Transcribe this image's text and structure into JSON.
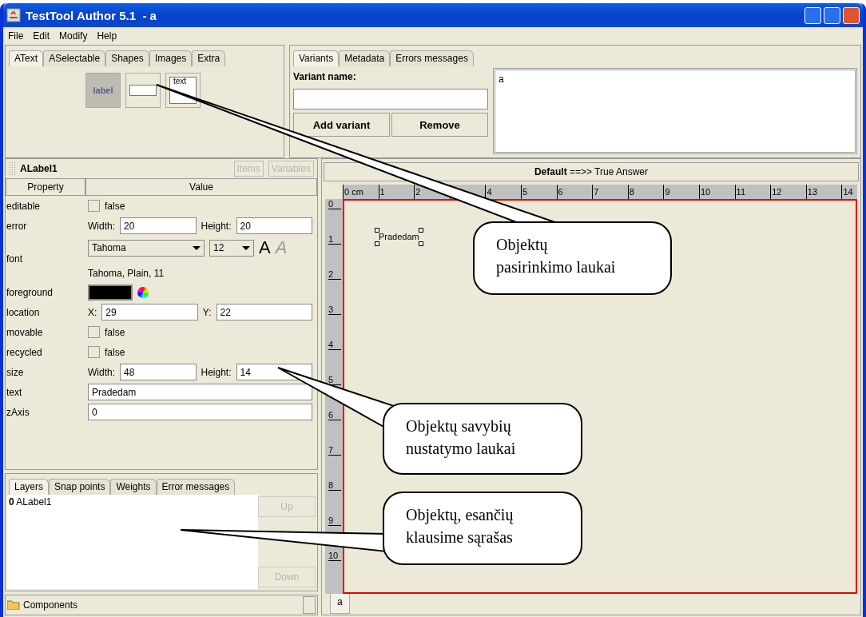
{
  "window": {
    "title": "TestTool Author 5.1  - a"
  },
  "menu": [
    "File",
    "Edit",
    "Modify",
    "Help"
  ],
  "palette": {
    "tabs": [
      {
        "label": "AText",
        "selected": true
      },
      {
        "label": "ASelectable",
        "selected": false
      },
      {
        "label": "Shapes",
        "selected": false
      },
      {
        "label": "Images",
        "selected": false
      },
      {
        "label": "Extra",
        "selected": false
      }
    ],
    "tools": [
      {
        "kind": "label",
        "text": "label",
        "selected": true
      },
      {
        "kind": "textfield",
        "selected": false
      },
      {
        "kind": "textarea",
        "text": "text",
        "selected": false
      }
    ]
  },
  "variants": {
    "tabs": [
      {
        "label": "Variants",
        "selected": true
      },
      {
        "label": "Metadata",
        "selected": false
      },
      {
        "label": "Errors messages",
        "selected": false
      }
    ],
    "name_label": "Variant name:",
    "buttons": [
      "Add variant",
      "Remove"
    ],
    "list": [
      "a"
    ]
  },
  "properties": {
    "title": "ALabel1",
    "buttons": [
      {
        "label": "Items",
        "disabled": true
      },
      {
        "label": "Variables",
        "disabled": true
      }
    ],
    "columns": [
      "Property",
      "Value"
    ],
    "rows": [
      {
        "name": "editable",
        "kind": "checkbox",
        "checked": false,
        "label": "false"
      },
      {
        "name": "error",
        "kind": "pair",
        "fields": [
          {
            "label": "Width:",
            "value": "20"
          },
          {
            "label": "Height:",
            "value": "20"
          }
        ]
      },
      {
        "name": "font",
        "kind": "font",
        "family": "Tahoma",
        "size": "12",
        "styles": [
          {
            "glyph": "A",
            "kind": "plain",
            "selected": true
          },
          {
            "glyph": "A",
            "kind": "italic",
            "selected": false
          }
        ],
        "description": "Tahoma, Plain, 11"
      },
      {
        "name": "foreground",
        "kind": "color",
        "color": "#000000"
      },
      {
        "name": "location",
        "kind": "pair",
        "fields": [
          {
            "label": "X:",
            "value": "29"
          },
          {
            "label": "Y:",
            "value": "22"
          }
        ]
      },
      {
        "name": "movable",
        "kind": "checkbox",
        "checked": false,
        "label": "false"
      },
      {
        "name": "recycled",
        "kind": "checkbox",
        "checked": false,
        "label": "false"
      },
      {
        "name": "size",
        "kind": "pair",
        "fields": [
          {
            "label": "Width:",
            "value": "48"
          },
          {
            "label": "Height:",
            "value": "14"
          }
        ]
      },
      {
        "name": "text",
        "kind": "text",
        "value": "Pradedam"
      },
      {
        "name": "zAxis",
        "kind": "text",
        "value": "0"
      }
    ]
  },
  "layers": {
    "tabs": [
      {
        "label": "Layers",
        "selected": true
      },
      {
        "label": "Snap points",
        "selected": false
      },
      {
        "label": "Weights",
        "selected": false
      },
      {
        "label": "Error messages",
        "selected": false
      }
    ],
    "items": [
      {
        "index": "0",
        "name": "ALabel1"
      }
    ],
    "buttons": [
      {
        "label": "Up",
        "disabled": true
      },
      {
        "label": "Down",
        "disabled": true
      }
    ]
  },
  "components": {
    "label": "Components"
  },
  "canvas": {
    "header": "**Default** ==>> True Answer",
    "x_ruler": {
      "labels_before_gap": [
        "0 cm",
        "1",
        "2"
      ],
      "labels_after_gap": [
        "4",
        "5",
        "6",
        "7",
        "8",
        "9",
        "10",
        "11",
        "12",
        "13",
        "14"
      ]
    },
    "y_ticks": [
      "0",
      "1",
      "2",
      "3",
      "4",
      "5",
      "6",
      "7",
      "8",
      "9",
      "10"
    ],
    "objects": [
      {
        "text": "Pradedam",
        "selected": true
      }
    ],
    "tabs": [
      {
        "label": "a",
        "selected": true
      }
    ]
  },
  "callouts": [
    {
      "text": "Objektų\npasirinkimo laukai"
    },
    {
      "text": "Objektų savybių\nnustatymo laukai"
    },
    {
      "text": "Objektų, esančių\nklausime sąrašas"
    }
  ]
}
